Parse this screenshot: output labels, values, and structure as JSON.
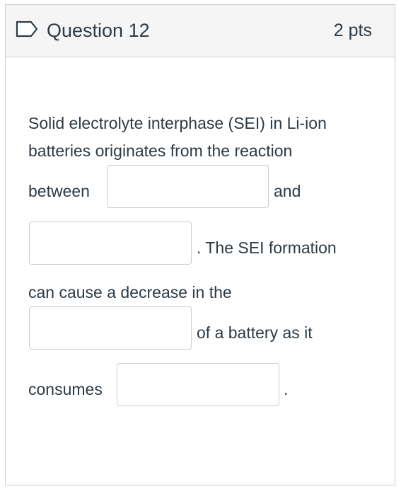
{
  "question": {
    "title": "Question 12",
    "points": "2 pts"
  },
  "body": {
    "line1": "Solid electrolyte interphase (SEI) in Li-ion",
    "line2": "batteries originates from the reaction",
    "line3_before": "between",
    "line3_after": "and",
    "line4_after": ". The SEI formation",
    "line5": "can cause a decrease in the",
    "line6_after": "of a battery as it",
    "line7_before": "consumes",
    "line7_after": "."
  },
  "blanks": [
    {
      "value": ""
    },
    {
      "value": ""
    },
    {
      "value": ""
    },
    {
      "value": ""
    }
  ],
  "colors": {
    "text": "#2d3b45",
    "border": "#c7cdd1",
    "header_bg": "#f5f5f5"
  },
  "icons": {
    "flag": "bookmark-flag-icon"
  }
}
